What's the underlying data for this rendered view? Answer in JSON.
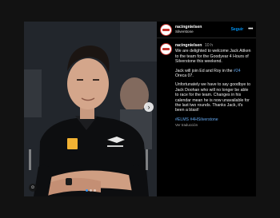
{
  "post": {
    "username": "racingnielsen",
    "location": "Silverstone",
    "follow_label": "Seguir",
    "more_icon": "•••",
    "next_icon": "›",
    "tag_icon": "☺",
    "caption": {
      "username": "racingnielsen",
      "time": "10 h",
      "p1": "We are delighted to welcome Jack Aitken to the team for the Goodyear 4 Hours of Silverstone this weekend.",
      "p2_before": "Jack will join Ed and Roy in the ",
      "p2_highlight": "#24",
      "p2_after": " Oreca 07.",
      "p3": "Unfortunately we have to say goodbye to Jack Doohan who will no longer be able to race for the team. Changes in his calendar mean he is now unavailable for the last two rounds. Thanks Jack, it's been a blast!",
      "hashtags": "#ELMS #4HSilverstone",
      "see_translation": "Ver traducción"
    },
    "carousel": {
      "count": 3,
      "active_index": 0
    },
    "colors": {
      "accent": "#0095f6",
      "hashtag": "#63a7ee",
      "brand": "#c4302b"
    }
  }
}
